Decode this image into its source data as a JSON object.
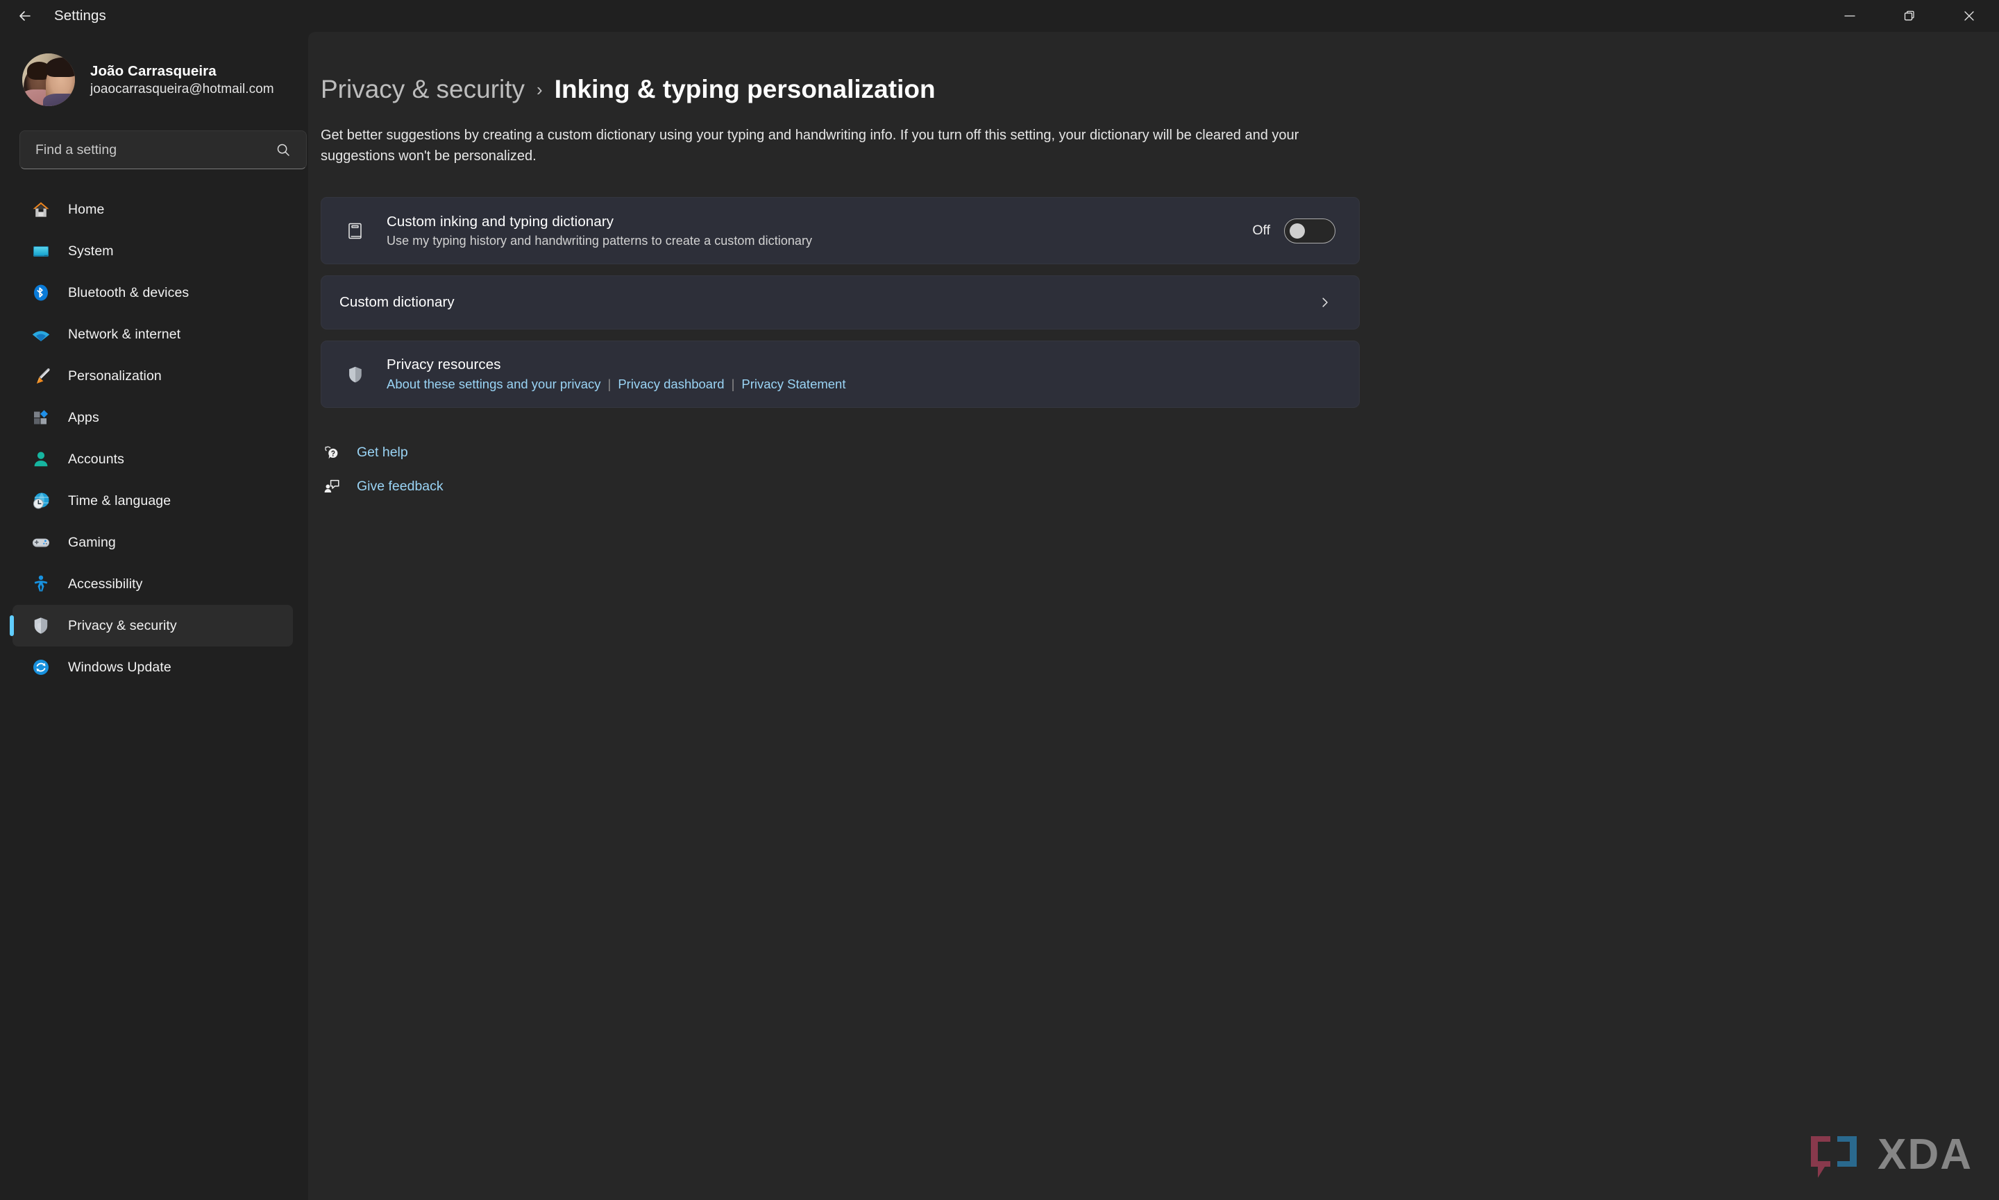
{
  "window": {
    "title": "Settings",
    "back_label": "Back",
    "minimize_label": "Minimize",
    "maximize_label": "Restore",
    "close_label": "Close"
  },
  "account": {
    "name": "João Carrasqueira",
    "email": "joaocarrasqueira@hotmail.com",
    "avatar_alt": "User profile photo"
  },
  "search": {
    "placeholder": "Find a setting",
    "value": "",
    "icon": "search-icon"
  },
  "sidebar": {
    "items": [
      {
        "label": "Home",
        "icon": "home-icon",
        "active": false
      },
      {
        "label": "System",
        "icon": "system-icon",
        "active": false
      },
      {
        "label": "Bluetooth & devices",
        "icon": "bluetooth-icon",
        "active": false
      },
      {
        "label": "Network & internet",
        "icon": "wifi-icon",
        "active": false
      },
      {
        "label": "Personalization",
        "icon": "paintbrush-icon",
        "active": false
      },
      {
        "label": "Apps",
        "icon": "apps-icon",
        "active": false
      },
      {
        "label": "Accounts",
        "icon": "person-icon",
        "active": false
      },
      {
        "label": "Time & language",
        "icon": "clock-globe-icon",
        "active": false
      },
      {
        "label": "Gaming",
        "icon": "gamepad-icon",
        "active": false
      },
      {
        "label": "Accessibility",
        "icon": "accessibility-icon",
        "active": false
      },
      {
        "label": "Privacy & security",
        "icon": "shield-icon",
        "active": true
      },
      {
        "label": "Windows Update",
        "icon": "update-icon",
        "active": false
      }
    ]
  },
  "main": {
    "breadcrumb": {
      "root": "Privacy & security",
      "separator": "›",
      "current": "Inking & typing personalization"
    },
    "description": "Get better suggestions by creating a custom dictionary using your typing and handwriting info. If you turn off this setting, your dictionary will be cleared and your suggestions won't be personalized.",
    "cards": {
      "dictionary_toggle": {
        "icon": "book-icon",
        "title": "Custom inking and typing dictionary",
        "subtitle": "Use my typing history and handwriting patterns to create a custom dictionary",
        "toggle_state": "Off",
        "toggle_on": false
      },
      "custom_dictionary": {
        "title": "Custom dictionary",
        "chevron": "chevron-right-icon"
      },
      "privacy_resources": {
        "icon": "shield-icon",
        "title": "Privacy resources",
        "separator": "|",
        "links": [
          "About these settings and your privacy",
          "Privacy dashboard",
          "Privacy Statement"
        ]
      }
    },
    "footer_links": [
      {
        "label": "Get help",
        "icon": "help-icon"
      },
      {
        "label": "Give feedback",
        "icon": "feedback-icon"
      }
    ]
  },
  "watermark": {
    "text": "XDA"
  },
  "colors": {
    "accent": "#60cdff",
    "link": "#9ad4f5",
    "sidebar_bg": "#202020",
    "main_bg": "#272727",
    "card_bg": "#2d2f39"
  }
}
